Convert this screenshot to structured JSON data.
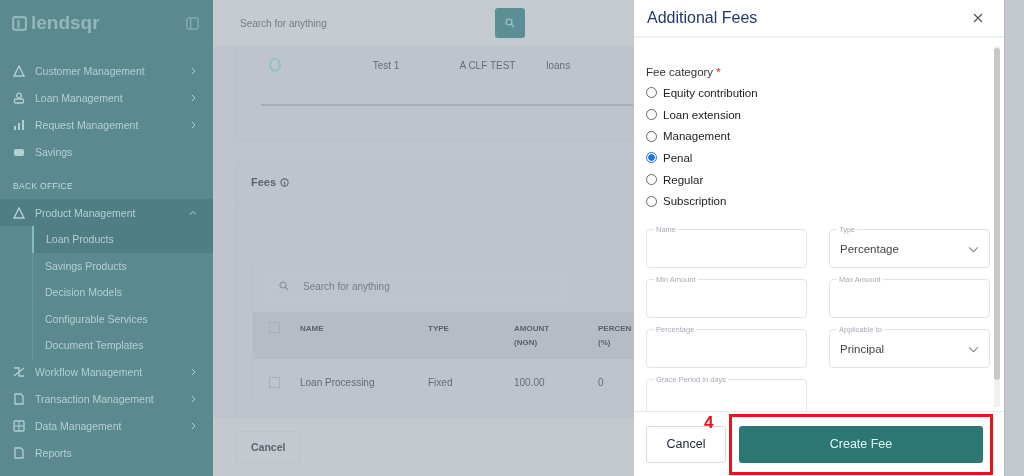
{
  "sidebar": {
    "logo": "lendsqr",
    "items": [
      {
        "kind": "nav",
        "label": "Customer Management",
        "expandable": true,
        "expanded": false,
        "selected": false
      },
      {
        "kind": "nav",
        "label": "Loan Management",
        "expandable": true,
        "expanded": false,
        "selected": false
      },
      {
        "kind": "nav",
        "label": "Request Management",
        "expandable": true,
        "expanded": false,
        "selected": false
      },
      {
        "kind": "nav",
        "label": "Savings",
        "expandable": false,
        "selected": false
      },
      {
        "kind": "section",
        "label": "BACK OFFICE"
      },
      {
        "kind": "nav",
        "label": "Product Management",
        "expandable": true,
        "expanded": true,
        "selected": true,
        "children": [
          {
            "label": "Loan Products",
            "selected": true
          },
          {
            "label": "Savings Products",
            "selected": false
          },
          {
            "label": "Decision Models",
            "selected": false
          },
          {
            "label": "Configurable Services",
            "selected": false
          },
          {
            "label": "Document Templates",
            "selected": false
          }
        ]
      },
      {
        "kind": "nav",
        "label": "Workflow Management",
        "expandable": true,
        "expanded": false,
        "selected": false
      },
      {
        "kind": "nav",
        "label": "Transaction Management",
        "expandable": true,
        "expanded": false,
        "selected": false
      },
      {
        "kind": "nav",
        "label": "Data Management",
        "expandable": true,
        "expanded": false,
        "selected": false
      },
      {
        "kind": "nav",
        "label": "Reports",
        "expandable": false,
        "selected": false
      }
    ]
  },
  "topbar": {
    "search": {
      "placeholder": "Search for anything"
    }
  },
  "product_table": {
    "rows": [
      {
        "selected": false,
        "cells": [
          "Test 1",
          "A CLF TEST",
          "loans"
        ]
      }
    ]
  },
  "fees": {
    "title": "Fees",
    "search": {
      "placeholder": "Search for anything"
    },
    "all_checked": false,
    "columns": [
      "NAME",
      "TYPE",
      "AMOUNT (NGN)",
      "PERCEN (%)"
    ],
    "rows": [
      {
        "checked": false,
        "cells": [
          "Loan Processing",
          "Fixed",
          "100.00",
          "0"
        ]
      }
    ]
  },
  "footer": {
    "buttons": [
      "Cancel"
    ]
  },
  "drawer": {
    "title": "Additional Fees",
    "fee_category": {
      "label": "Fee category",
      "required_mark": "*",
      "options": [
        {
          "label": "Equity contribution",
          "selected": false
        },
        {
          "label": "Loan extension",
          "selected": false
        },
        {
          "label": "Management",
          "selected": false
        },
        {
          "label": "Penal",
          "selected": true
        },
        {
          "label": "Regular",
          "selected": false
        },
        {
          "label": "Subscription",
          "selected": false
        }
      ]
    },
    "fields": [
      {
        "kind": "text",
        "label": "Name"
      },
      {
        "kind": "select",
        "label": "Type",
        "value": "Percentage"
      },
      {
        "kind": "text",
        "label": "Min Amount"
      },
      {
        "kind": "text",
        "label": "Max Amount"
      },
      {
        "kind": "text",
        "label": "Percentage"
      },
      {
        "kind": "select",
        "label": "Applicable to",
        "value": "Principal"
      },
      {
        "kind": "text",
        "label": "Grace Period in days"
      }
    ],
    "buttons": [
      {
        "kind": "secondary",
        "label": "Cancel"
      },
      {
        "kind": "primary",
        "label": "Create Fee"
      }
    ],
    "annotation": {
      "label": "4"
    }
  }
}
